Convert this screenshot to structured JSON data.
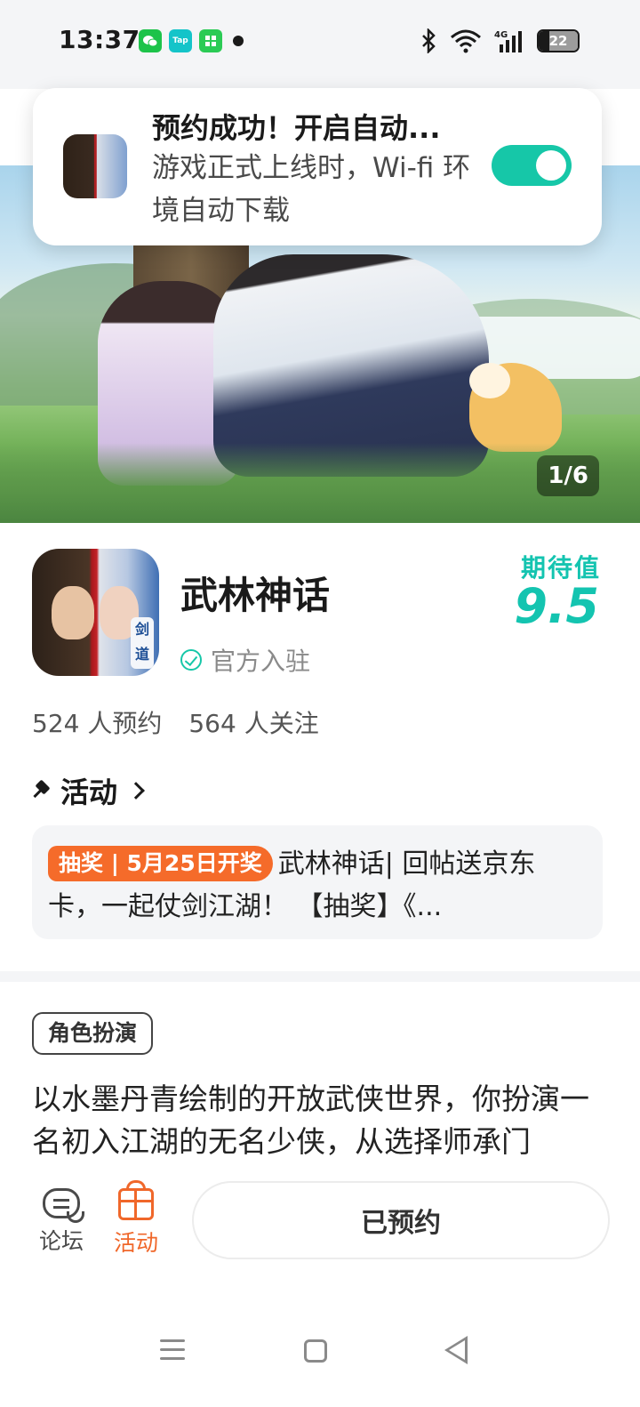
{
  "status_bar": {
    "time": "13:37",
    "app_icons": [
      "wechat-icon",
      "tap-icon",
      "store-icon"
    ],
    "tap_label": "Tap",
    "battery": "22"
  },
  "notification": {
    "title": "预约成功！开启自动...",
    "body": "游戏正式上线时，Wi-fi 环境自动下载",
    "toggle_on": true,
    "toggle_color": "#16c7a8"
  },
  "hero": {
    "counter": "1/6"
  },
  "game": {
    "name": "武林神话",
    "official_label": "官方入驻",
    "icon_tag": "剑道",
    "score_label": "期待值",
    "score": "9.5",
    "reservations": "524 人预约",
    "followers": "564 人关注"
  },
  "activity": {
    "title": "活动",
    "badge": "抽奖 | 5月25日开奖",
    "text": "武林神话| 回帖送京东卡，一起仗剑江湖！ 【抽奖】《..."
  },
  "details": {
    "genre_tag": "角色扮演",
    "description": "以水墨丹青绘制的开放武侠世界，你扮演一名初入江湖的无名少侠，从选择师承门"
  },
  "bottom_bar": {
    "forum_label": "论坛",
    "activity_label": "活动",
    "reserve_button": "已预约",
    "accent_color": "#f0672a"
  },
  "colors": {
    "brand_teal": "#14c4b0",
    "badge_orange": "#f56b2a"
  }
}
